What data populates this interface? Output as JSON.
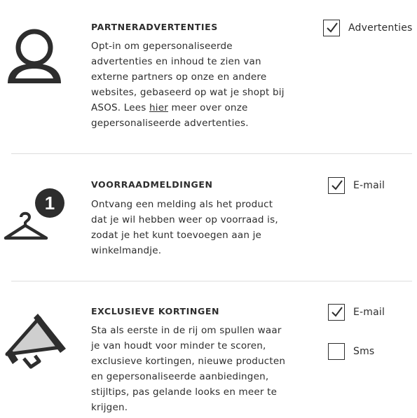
{
  "sections": [
    {
      "title": "PARTNERADVERTENTIES",
      "desc_before": "Opt-in om gepersonaliseerde advertenties en inhoud te zien van externe partners op onze en andere websites, gebaseerd op wat je shopt bij ASOS. Lees ",
      "desc_link": "hier",
      "desc_after": " meer over onze gepersonaliseerde advertenties.",
      "options": [
        {
          "label": "Advertenties",
          "checked": true
        }
      ]
    },
    {
      "title": "VOORRAADMELDINGEN",
      "desc": "Ontvang een melding als het product dat je wil hebben weer op voorraad is, zodat je het kunt toevoegen aan je winkelmandje.",
      "badge": "1",
      "options": [
        {
          "label": "E-mail",
          "checked": true
        }
      ]
    },
    {
      "title": "EXCLUSIEVE KORTINGEN",
      "desc": "Sta als eerste in de rij om spullen waar je van houdt voor minder te scoren, exclusieve kortingen, nieuwe producten en gepersonaliseerde aanbiedingen, stijltips, pas gelande looks en meer te krijgen.",
      "options": [
        {
          "label": "E-mail",
          "checked": true
        },
        {
          "label": "Sms",
          "checked": false
        }
      ]
    }
  ],
  "colors": {
    "text": "#2d2d2d",
    "divider": "#dddddd",
    "icon": "#2d2d2d",
    "megaphone_fill": "#cfcfcf"
  },
  "icons": [
    "person-icon",
    "hanger-icon",
    "megaphone-icon",
    "checkmark-icon"
  ]
}
